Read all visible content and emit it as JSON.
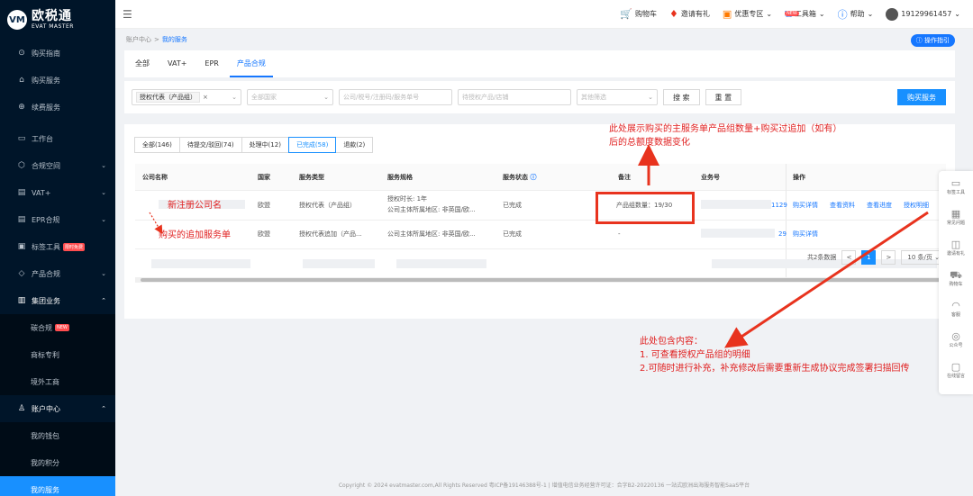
{
  "brand": {
    "logo_mark": "VM",
    "name_cn": "欧税通",
    "name_en": "EVAT MASTER"
  },
  "sidebar": {
    "items": [
      {
        "icon": "⊙",
        "label": "购买指南"
      },
      {
        "icon": "⌂",
        "label": "购买服务"
      },
      {
        "icon": "⊕",
        "label": "续费服务"
      },
      {
        "icon": "▭",
        "label": "工作台"
      },
      {
        "icon": "⬡",
        "label": "合规空间",
        "chev": "⌄"
      },
      {
        "icon": "▤",
        "label": "VAT+",
        "chev": "⌄"
      },
      {
        "icon": "▤",
        "label": "EPR合规",
        "chev": "⌄"
      },
      {
        "icon": "▣",
        "label": "标签工具",
        "tag": "限时免费"
      },
      {
        "icon": "◇",
        "label": "产品合规",
        "chev": "⌄"
      },
      {
        "icon": "▥",
        "label": "集团业务",
        "chev": "⌃"
      },
      {
        "label": "碳合规",
        "tag": "NEW"
      },
      {
        "label": "商标专利"
      },
      {
        "label": "境外工商"
      },
      {
        "icon": "♙",
        "label": "账户中心",
        "chev": "⌃"
      },
      {
        "label": "我的钱包"
      },
      {
        "label": "我的积分"
      },
      {
        "label": "我的服务"
      }
    ]
  },
  "topbar": {
    "cart": "购物车",
    "invite": "邀请有礼",
    "promo": "优惠专区",
    "tools": "工具箱",
    "tools_badge": "NEW",
    "help": "帮助",
    "phone": "19129961457"
  },
  "breadcrumb": {
    "parent": "账户中心",
    "sep": ">",
    "current": "我的服务"
  },
  "guide_btn": "操作指引",
  "tabs": [
    "全部",
    "VAT+",
    "EPR",
    "产品合规"
  ],
  "filters": {
    "chip": "授权代表（产品组）",
    "chip_x": "×",
    "country": "全部国家",
    "search": "公司/税号/注册码/服务单号",
    "target": "待授权产品/店铺",
    "other": "其他筛选",
    "search_btn": "搜 索",
    "reset_btn": "重 置",
    "buy_btn": "购买服务"
  },
  "status_tabs": [
    "全部(146)",
    "待提交/驳回(74)",
    "处理中(12)",
    "已完成(58)",
    "退款(2)"
  ],
  "table": {
    "headers": [
      "公司名称",
      "国家",
      "服务类型",
      "服务规格",
      "服务状态",
      "备注",
      "业务号",
      "操作"
    ],
    "status_info_icon": "ⓘ",
    "rows": [
      {
        "country": "欧盟",
        "type": "授权代表（产品组）",
        "spec1": "授权时长: 1年",
        "spec2": "公司主体所属地区: 非英国/欧...",
        "status": "已完成",
        "note": "产品组数量：19/30",
        "biz": "1129",
        "ops": [
          "购买详情",
          "查看资料",
          "查看进度",
          "授权明细"
        ]
      },
      {
        "country": "欧盟",
        "type": "授权代表追加（产品...",
        "spec1": "公司主体所属地区: 非英国/欧...",
        "status": "已完成",
        "note": "-",
        "biz": "29",
        "ops": [
          "购买详情"
        ]
      }
    ]
  },
  "pagination": {
    "total": "共2条数据",
    "page": "1",
    "size": "10 条/页",
    "prev": "<",
    "next": ">"
  },
  "annotations": {
    "top": "此处展示购买的主服务单产品组数量+购买过追加（如有）",
    "top2": "后的总额度数据变化",
    "company": "新注册公司名",
    "added": "购买的追加服务单",
    "bottom1": "此处包含内容：",
    "bottom2": "1. 可查看授权产品组的明细",
    "bottom3": "2.可随时进行补充，补充修改后需要重新生成协议完成签署扫描回传"
  },
  "rightbar": [
    "标签工具",
    "常见问题",
    "邀请有礼",
    "购物车",
    "客服",
    "公众号",
    "在线留言"
  ],
  "footer": "Copyright © 2024 evatmaster.com,All Rights Reserved 粤ICP备19146388号-1 | 增值电信业务经营许可证：合字B2-20220136    一站式欧洲出海服务智能SaaS平台",
  "colors": {
    "primary": "#1890ff",
    "annotation": "#e02020",
    "sidebar": "#001529"
  }
}
